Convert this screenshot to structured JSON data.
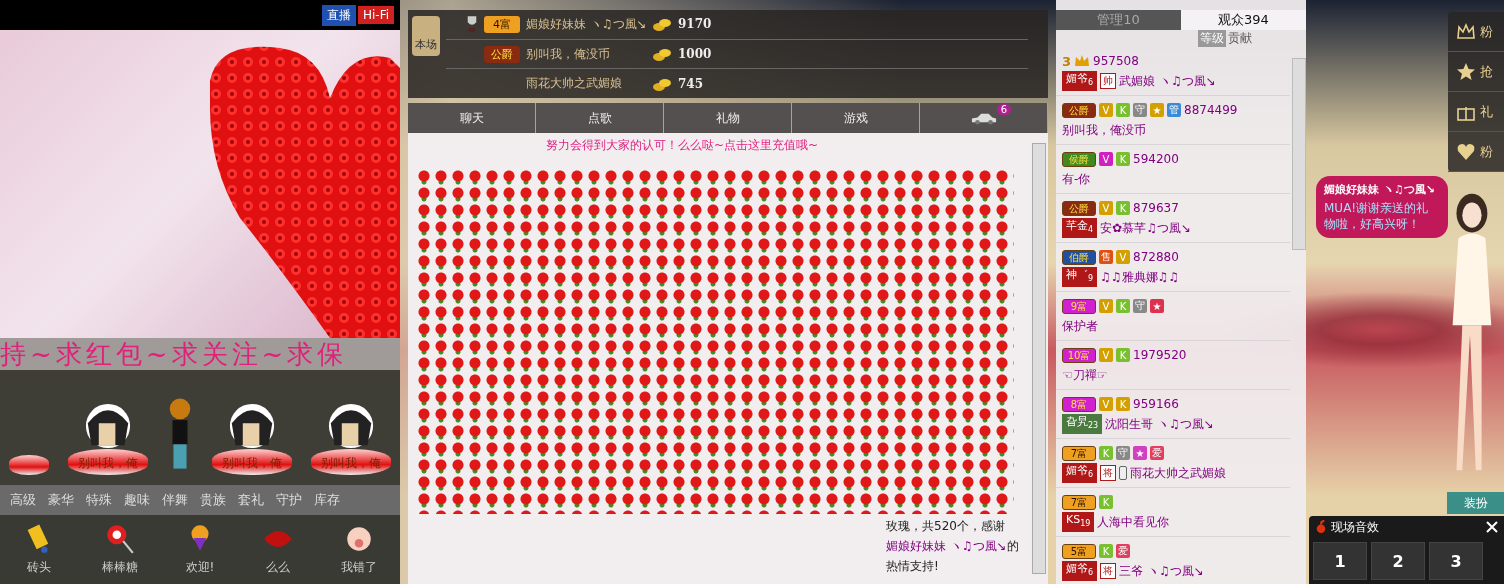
{
  "stream_header": {
    "buttons": [
      {
        "label": "直播",
        "kind": "live"
      },
      {
        "label": "Hi-Fi",
        "kind": "hifi"
      }
    ]
  },
  "banner": {
    "text": "持~求红包~求关注~求保"
  },
  "seats": [
    {
      "kind": "pedestal"
    },
    {
      "kind": "avatar",
      "label": "别叫我，俺"
    },
    {
      "kind": "character"
    },
    {
      "kind": "avatar",
      "label": "别叫我，俺"
    },
    {
      "kind": "avatar",
      "label": "别叫我，俺"
    }
  ],
  "gift_tabs": [
    {
      "label": "高级",
      "selected": false
    },
    {
      "label": "豪华",
      "selected": false
    },
    {
      "label": "特殊",
      "selected": false
    },
    {
      "label": "趣味",
      "selected": false
    },
    {
      "label": "伴舞",
      "selected": false
    },
    {
      "label": "贵族",
      "selected": false
    },
    {
      "label": "套礼",
      "selected": false
    },
    {
      "label": "守护",
      "selected": false
    },
    {
      "label": "库存",
      "selected": false
    }
  ],
  "gifts": [
    {
      "kind": "brick",
      "label": "砖头"
    },
    {
      "kind": "lollipop",
      "label": "棒棒糖"
    },
    {
      "kind": "balloon",
      "label": "欢迎!"
    },
    {
      "kind": "lips",
      "label": "么么"
    },
    {
      "kind": "pig",
      "label": "我错了"
    }
  ],
  "ranking": {
    "tag": "本场",
    "rows": [
      {
        "rank": "4富",
        "color": "#f0a020",
        "name": "媚娘好妹妹 ヽ♫つ風↘",
        "coins": "9170"
      },
      {
        "rank": "公爵",
        "color": "#8a2a10",
        "name": "别叫我，俺没币",
        "coins": "1000"
      },
      {
        "name": "雨花大帅之武媚娘",
        "coins": "745"
      }
    ]
  },
  "chat_tabs": [
    {
      "label": "聊天",
      "kind": "text",
      "selected": false
    },
    {
      "label": "点歌",
      "kind": "text",
      "selected": false
    },
    {
      "label": "礼物",
      "kind": "text",
      "selected": false
    },
    {
      "label": "游戏",
      "kind": "text",
      "selected": false
    },
    {
      "kind": "car",
      "count": "6",
      "selected": false
    }
  ],
  "notice": "努力会得到大家的认可！么么哒~点击这里充值哦~",
  "chat_message": {
    "before": "玫瑰，共520个，感谢 ",
    "sender": "媚娘好妹妹 ヽ♫つ風↘",
    "after": "的热情支持!"
  },
  "audience_tabs": [
    {
      "label": "管理10",
      "selected": false
    },
    {
      "label": "观众394",
      "selected": true
    }
  ],
  "sort_options": [
    {
      "label": "等级",
      "selected": true
    },
    {
      "label": "贡献",
      "selected": false
    }
  ],
  "users": [
    {
      "rank": "3",
      "kind": "crown",
      "color": "#c08010",
      "id": "957508",
      "tag": {
        "label": "媚爷",
        "level": "6",
        "extra": "帅"
      },
      "phone": false,
      "name": "武媚娘 ヽ♫つ風↘"
    },
    {
      "rank": "公爵",
      "kind": "bar",
      "color": "#8a2a10",
      "badges": [
        {
          "label": "V",
          "color": "#d4a000"
        },
        {
          "label": "K",
          "color": "#78c030"
        },
        {
          "label": "守",
          "color": "#888888"
        },
        {
          "label": "★",
          "color": "#d4a000"
        },
        {
          "label": "管",
          "color": "#3a8ad8"
        }
      ],
      "id": "8874499",
      "phone": false,
      "name": "别叫我，俺没币"
    },
    {
      "rank": "侯爵",
      "kind": "bar",
      "color": "#3f8a20",
      "badges": [
        {
          "label": "V",
          "color": "#d020c0"
        },
        {
          "label": "K",
          "color": "#78c030"
        }
      ],
      "id": "594200",
      "phone": false,
      "name": "有-你"
    },
    {
      "rank": "公爵",
      "kind": "bar",
      "color": "#8a2a10",
      "badges": [
        {
          "label": "V",
          "color": "#d4a000"
        },
        {
          "label": "K",
          "color": "#78c030"
        }
      ],
      "id": "879637",
      "tag": {
        "label": "芊金",
        "level": "4"
      },
      "phone": false,
      "name": "安✿慕芊♫つ風↘"
    },
    {
      "rank": "伯爵",
      "kind": "bar",
      "color": "#2050a0",
      "badges": [
        {
          "label": "售",
          "color": "#e05010"
        },
        {
          "label": "V",
          "color": "#d4a000"
        }
      ],
      "id": "872880",
      "tag": {
        "label": "神゛",
        "level": "9"
      },
      "phone": false,
      "name": "♫♫雅典娜♫♫"
    },
    {
      "rank": "9富",
      "kind": "bar",
      "color": "#d020d0",
      "badges": [
        {
          "label": "V",
          "color": "#d4a000"
        },
        {
          "label": "K",
          "color": "#78c030"
        },
        {
          "label": "守",
          "color": "#888888"
        },
        {
          "label": "★",
          "color": "#e03050"
        }
      ],
      "phone": false,
      "name": "保护者"
    },
    {
      "rank": "10富",
      "kind": "bar",
      "color": "#d020d0",
      "badges": [
        {
          "label": "V",
          "color": "#d4a000"
        },
        {
          "label": "K",
          "color": "#78c030"
        }
      ],
      "id": "1979520",
      "phone": false,
      "name": "☜刀禪☞"
    },
    {
      "rank": "8富",
      "kind": "bar",
      "color": "#d020d0",
      "badges": [
        {
          "label": "V",
          "color": "#d4a000"
        },
        {
          "label": "K",
          "color": "#d4a000"
        }
      ],
      "id": "959166",
      "tag": {
        "label": "旮旯",
        "level": "23",
        "color": "#4a7a40"
      },
      "phone": false,
      "name": "沈阳生哥 ヽ♫つ風↘"
    },
    {
      "rank": "7富",
      "kind": "bar",
      "color": "#f0a020",
      "badges": [
        {
          "label": "K",
          "color": "#78c030"
        },
        {
          "label": "守",
          "color": "#888888"
        },
        {
          "label": "★",
          "color": "#d040c0"
        },
        {
          "label": "爱",
          "color": "#e04060"
        }
      ],
      "tag": {
        "label": "媚爷",
        "level": "6",
        "extra": "将"
      },
      "phone": true,
      "name": "雨花大帅之武媚娘"
    },
    {
      "rank": "7富",
      "kind": "bar",
      "color": "#f0a020",
      "badges": [
        {
          "label": "K",
          "color": "#78c030"
        }
      ],
      "tag": {
        "label": "KS",
        "level": "19"
      },
      "phone": false,
      "name": "人海中看见你"
    },
    {
      "rank": "5富",
      "kind": "bar",
      "color": "#f0a020",
      "badges": [
        {
          "label": "K",
          "color": "#78c030"
        },
        {
          "label": "爱",
          "color": "#e04060"
        }
      ],
      "tag": {
        "label": "媚爷",
        "level": "6",
        "extra": "将"
      },
      "phone": false,
      "name": "三爷 ヽ♫つ風↘"
    }
  ],
  "side_menu": [
    {
      "kind": "crown",
      "label": "粉"
    },
    {
      "kind": "star",
      "label": "抢"
    },
    {
      "kind": "gift",
      "label": "礼"
    },
    {
      "kind": "heart",
      "label": "粉"
    }
  ],
  "speech_bubble": {
    "name": "媚娘好妹妹 ヽ♫つ風↘",
    "text": "MUA!谢谢亲送的礼物啦，好高兴呀！"
  },
  "dress_button": "装扮",
  "sound_panel": {
    "title": "现场音效",
    "keys": [
      "1",
      "2",
      "3"
    ]
  }
}
